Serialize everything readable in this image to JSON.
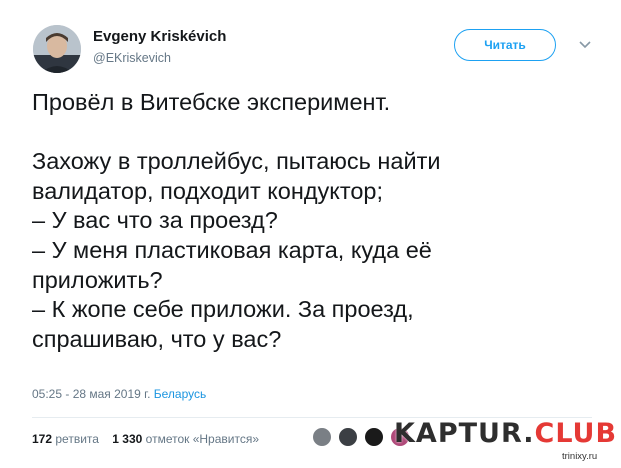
{
  "author": {
    "name": "Evgeny Kriskévich",
    "handle": "@EKriskevich"
  },
  "follow_button": "Читать",
  "tweet": {
    "lines": [
      "Провёл в Витебске эксперимент.",
      "",
      "Захожу в троллейбус, пытаюсь найти",
      "валидатор, подходит кондуктор;",
      "– У вас что за проезд?",
      "– У меня пластиковая карта, куда её",
      "приложить?",
      "– К жопе себе приложи. За проезд,",
      "спрашиваю, что у вас?"
    ],
    "timestamp": "05:25 - 28 мая 2019 г.",
    "location": "Беларусь"
  },
  "stats": {
    "retweets_count": "172",
    "retweets_label": "ретвита",
    "likes_count": "1 330",
    "likes_label": "отметок «Нравится»"
  },
  "liker_colors": [
    "#7a7f85",
    "#3b3f44",
    "#1a1a1a",
    "#b04a7a"
  ],
  "watermark": {
    "part_a": "KAPTUR.",
    "part_b": "CLUB",
    "site": "trinixy.ru"
  },
  "colors": {
    "accent": "#1da1f2",
    "text": "#14171a",
    "secondary": "#657786"
  }
}
